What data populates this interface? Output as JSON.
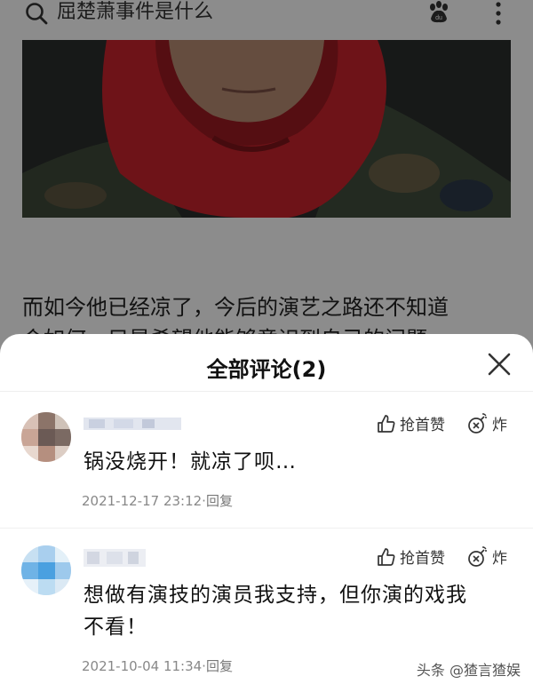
{
  "search": {
    "query": "屈楚萧事件是什么"
  },
  "article": {
    "line1": "而如今他已经凉了，今后的演艺之路还不知道",
    "line2": "会如何，只是希望他能够意识到自己的问题"
  },
  "comments_panel": {
    "title": "全部评论(2)",
    "comments": [
      {
        "text": "锅没烧开！就凉了呗…",
        "timestamp": "2021-12-17 23:12",
        "separator": "·",
        "reply_label": "回复",
        "like_label": "抢首赞",
        "bomb_label": "炸"
      },
      {
        "text_line1": "想做有演技的演员我支持，但你演的戏我",
        "text_line2": "不看！",
        "timestamp": "2021-10-04 11:34",
        "separator": "·",
        "reply_label": "回复",
        "like_label": "抢首赞",
        "bomb_label": "炸"
      }
    ]
  },
  "watermark": "头条 @猹言猹娱",
  "colors": {
    "dim_overlay": "#737373",
    "hood_red": "#c8232c",
    "meta_gray": "#888888"
  }
}
